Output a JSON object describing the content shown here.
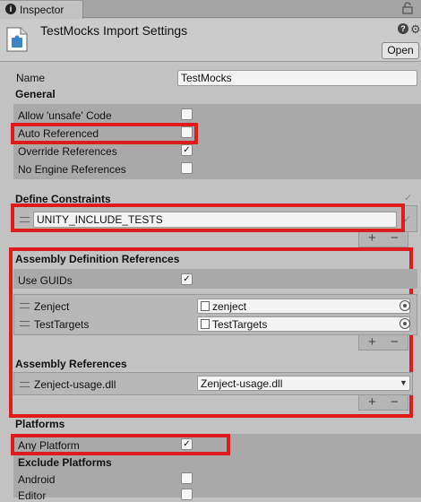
{
  "tab": {
    "label": "Inspector"
  },
  "header": {
    "title": "TestMocks Import Settings",
    "open_label": "Open"
  },
  "name_row": {
    "label": "Name",
    "value": "TestMocks"
  },
  "general": {
    "heading": "General",
    "allow_unsafe": {
      "label": "Allow 'unsafe' Code",
      "checked": false
    },
    "auto_referenced": {
      "label": "Auto Referenced",
      "checked": false
    },
    "override_references": {
      "label": "Override References",
      "checked": true,
      "mark": "✓"
    },
    "no_engine_references": {
      "label": "No Engine References",
      "checked": false
    }
  },
  "define_constraints": {
    "heading": "Define Constraints",
    "items": [
      "UNITY_INCLUDE_TESTS"
    ],
    "valid_mark": "✓",
    "plus": "+",
    "minus": "−"
  },
  "assembly_definition_references": {
    "heading": "Assembly Definition References",
    "use_guids": {
      "label": "Use GUIDs",
      "checked": true,
      "mark": "✓"
    },
    "items": [
      {
        "label": "Zenject",
        "value": "zenject"
      },
      {
        "label": "TestTargets",
        "value": "TestTargets"
      }
    ],
    "plus": "+",
    "minus": "−"
  },
  "assembly_references": {
    "heading": "Assembly References",
    "items": [
      {
        "label": "Zenject-usage.dll",
        "value": "Zenject-usage.dll"
      }
    ],
    "plus": "+",
    "minus": "−"
  },
  "platforms": {
    "heading": "Platforms",
    "any_platform": {
      "label": "Any Platform",
      "checked": true,
      "mark": "✓"
    },
    "exclude_heading": "Exclude Platforms",
    "exclude": [
      {
        "label": "Android",
        "checked": false
      },
      {
        "label": "Editor",
        "checked": false
      }
    ]
  },
  "colors": {
    "highlight": "#e01b1b",
    "band": "#a9a9a9",
    "background": "#c2c2c2"
  }
}
